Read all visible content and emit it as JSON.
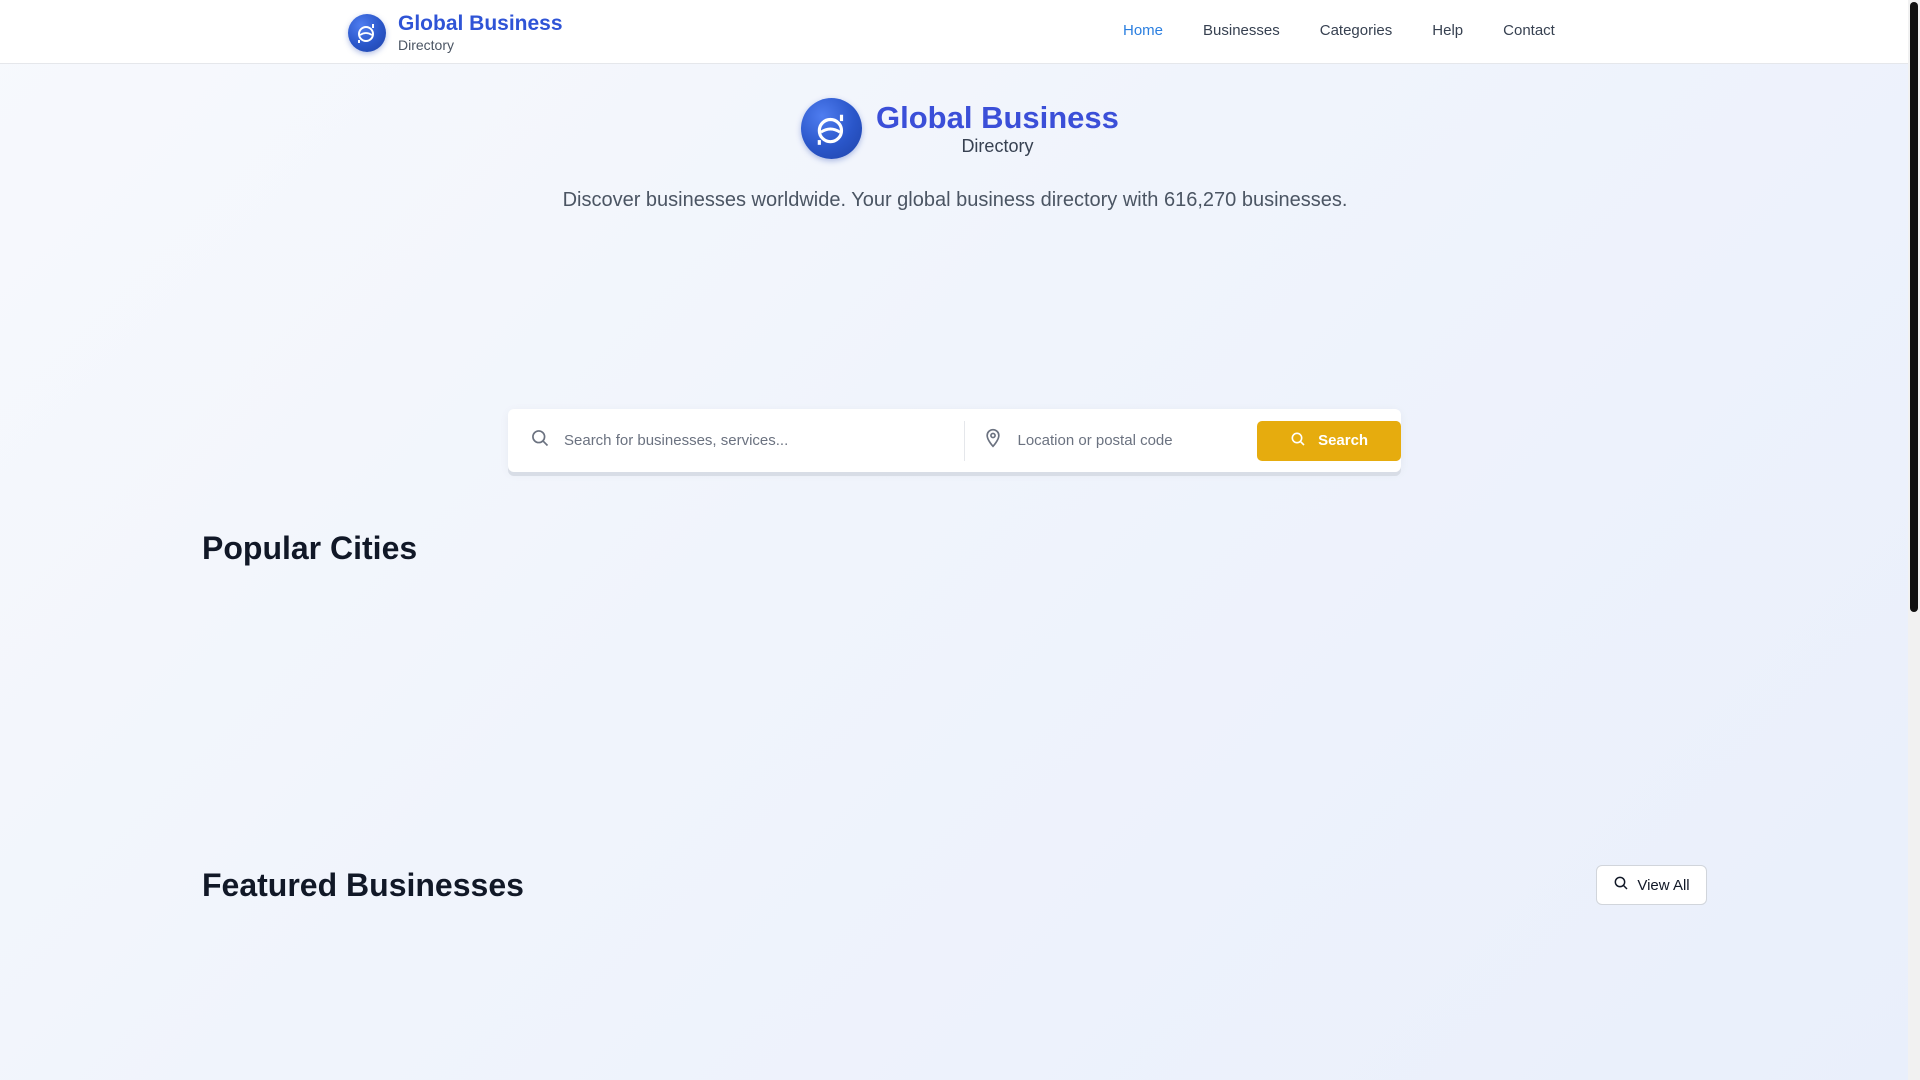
{
  "header": {
    "brand_title": "Global Business",
    "brand_subtitle": "Directory",
    "nav": [
      {
        "label": "Home",
        "active": true
      },
      {
        "label": "Businesses",
        "active": false
      },
      {
        "label": "Categories",
        "active": false
      },
      {
        "label": "Help",
        "active": false
      },
      {
        "label": "Contact",
        "active": false
      }
    ]
  },
  "hero": {
    "brand_title": "Global Business",
    "brand_subtitle": "Directory",
    "tagline": "Discover businesses worldwide. Your global business directory with 616,270 businesses."
  },
  "search": {
    "query_placeholder": "Search for businesses, services...",
    "query_value": "",
    "location_placeholder": "Location or postal code",
    "location_value": "",
    "button_label": "Search"
  },
  "sections": {
    "popular_cities_title": "Popular Cities",
    "featured_title": "Featured Businesses",
    "view_all_label": "View All"
  },
  "colors": {
    "brand_blue": "#2f54d6",
    "nav_active": "#2b7fe0",
    "search_button": "#e6ac0e"
  },
  "icons": {
    "logo": "globe-logo-icon",
    "search": "search-icon",
    "location": "map-pin-icon"
  }
}
